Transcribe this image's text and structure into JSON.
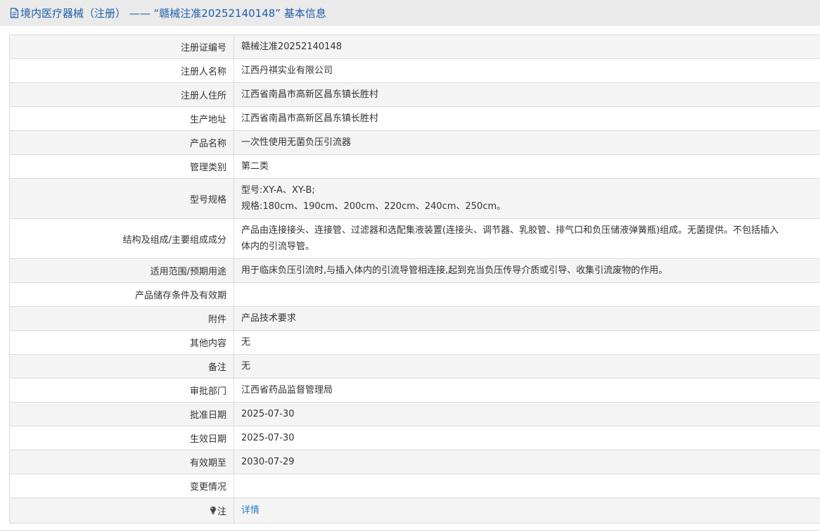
{
  "header": {
    "icon": "document-icon",
    "title": "境内医疗器械（注册） ——  “赣械注准20252140148”  基本信息"
  },
  "rows": [
    {
      "label": "注册证编号",
      "value": "赣械注准20252140148"
    },
    {
      "label": "注册人名称",
      "value": "江西丹祺实业有限公司"
    },
    {
      "label": "注册人住所",
      "value": "江西省南昌市高新区昌东镇长胜村"
    },
    {
      "label": "生产地址",
      "value": "江西省南昌市高新区昌东镇长胜村"
    },
    {
      "label": "产品名称",
      "value": "一次性使用无菌负压引流器"
    },
    {
      "label": "管理类别",
      "value": "第二类"
    },
    {
      "label": "型号规格",
      "lines": [
        "型号:XY-A、XY-B;",
        "规格:180cm、190cm、200cm、220cm、240cm、250cm。"
      ]
    },
    {
      "label": "结构及组成/主要组成成分",
      "lines": [
        "产品由连接接头、连接管、过滤器和选配集液装置(连接头、调节器、乳胶管、排气口和负压储液弹簧瓶)组成。无菌提供。不包括插入",
        "体内的引流导管。"
      ]
    },
    {
      "label": "适用范围/预期用途",
      "value": "用于临床负压引流时,与插入体内的引流导管相连接,起到充当负压传导介质或引导、收集引流废物的作用。"
    },
    {
      "label": "产品储存条件及有效期",
      "value": ""
    },
    {
      "label": "附件",
      "value": "产品技术要求"
    },
    {
      "label": "其他内容",
      "value": "无"
    },
    {
      "label": "备注",
      "value": "无"
    },
    {
      "label": "审批部门",
      "value": "江西省药品监督管理局"
    },
    {
      "label": "批准日期",
      "value": "2025-07-30"
    },
    {
      "label": "生效日期",
      "value": "2025-07-30"
    },
    {
      "label": "有效期至",
      "value": "2030-07-29"
    },
    {
      "label": "变更情况",
      "value": ""
    },
    {
      "label": "注",
      "label_icon": "lightbulb-icon",
      "link": "详情"
    }
  ],
  "colors": {
    "header_bg": "#eaeaea",
    "title_text": "#1f5eaa",
    "link": "#2a7ed0",
    "row_alt": "#f4f4f4",
    "border": "#dcdcdc"
  }
}
